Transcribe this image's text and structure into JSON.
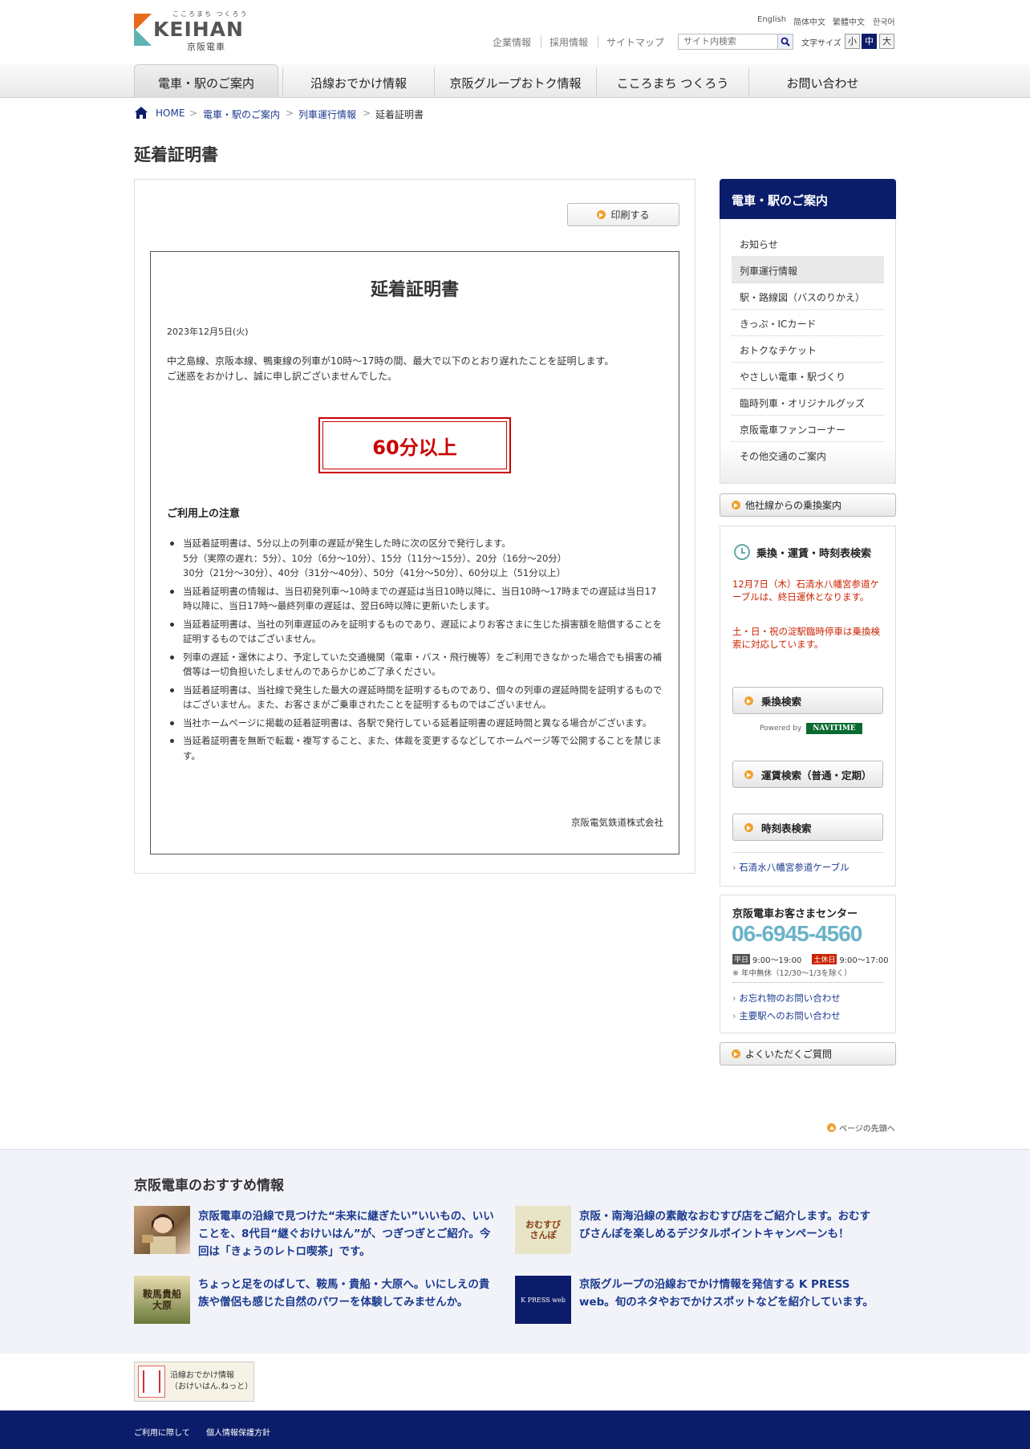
{
  "header": {
    "logo_ruby": "こころまち つくろう",
    "logo_main": "KEIHAN",
    "logo_jp": "京阪電車",
    "languages": [
      "English",
      "简体中文",
      "繁體中文",
      "한국어"
    ],
    "top_links": [
      "企業情報",
      "採用情報",
      "サイトマップ"
    ],
    "search_placeholder": "サイト内検索",
    "font_size_label": "文字サイズ",
    "font_sizes": [
      "小",
      "中",
      "大"
    ]
  },
  "gnav": [
    "電車・駅のご案内",
    "沿線おでかけ情報",
    "京阪グループおトク情報",
    "こころまち つくろう",
    "お問い合わせ"
  ],
  "breadcrumb": [
    "HOME",
    "電車・駅のご案内",
    "列車運行情報",
    "延着証明書"
  ],
  "page_title": "延着証明書",
  "print_label": "印刷する",
  "certificate": {
    "title": "延着証明書",
    "date": "2023年12月5日(火)",
    "body_line1": "中之島線、京阪本線、鴨東線の列車が10時～17時の間、最大で以下のとおり遅れたことを証明します。",
    "body_line2": "ご迷惑をおかけし、誠に申し訳ございませんでした。",
    "delay": "60分以上",
    "notes_heading": "ご利用上の注意",
    "notes": [
      [
        "当延着証明書は、5分以上の列車の遅延が発生した時に次の区分で発行します。",
        "5分（実際の遅れ：5分）、10分（6分～10分）、15分（11分～15分）、20分（16分～20分）",
        "30分（21分～30分）、40分（31分～40分）、50分（41分～50分）、60分以上（51分以上）"
      ],
      [
        "当延着証明書の情報は、当日初発列車～10時までの遅延は当日10時以降に、当日10時～17時までの遅延は当日17時以降に、当日17時～最終列車の遅延は、翌日6時以降に更新いたします。"
      ],
      [
        "当延着証明書は、当社の列車遅延のみを証明するものであり、遅延によりお客さまに生じた損害額を賠償することを証明するものではございません。"
      ],
      [
        "列車の遅延・運休により、予定していた交通機関（電車・バス・飛行機等）をご利用できなかった場合でも損害の補償等は一切負担いたしませんのであらかじめご了承ください。"
      ],
      [
        "当延着証明書は、当社線で発生した最大の遅延時間を証明するものであり、個々の列車の遅延時間を証明するものではございません。また、お客さまがご乗車されたことを証明するものではございません。"
      ],
      [
        "当社ホームページに掲載の延着証明書は、各駅で発行している延着証明書の遅延時間と異なる場合がございます。"
      ],
      [
        "当延着証明書を無断で転載・複写すること、また、体裁を変更するなどしてホームページ等で公開することを禁じます。"
      ]
    ],
    "signature": "京阪電気鉄道株式会社"
  },
  "sidebar": {
    "heading": "電車・駅のご案内",
    "items": [
      "お知らせ",
      "列車運行情報",
      "駅・路線図（バスのりかえ）",
      "きっぷ・ICカード",
      "おトクなチケット",
      "やさしい電車・駅づくり",
      "臨時列車・オリジナルグッズ",
      "京阪電車ファンコーナー",
      "その他交通のご案内"
    ],
    "other_lines": "他社線からの乗換案内",
    "transit_heading": "乗換・運賃・時刻表検索",
    "notice1": "12月7日（木）石清水八幡宮参道ケーブルは、終日運休となります。",
    "notice2": "土・日・祝の淀駅臨時停車は乗換検索に対応しています。",
    "transfer_btn": "乗換検索",
    "powered_by": "Powered by",
    "navitime": "NAVITIME",
    "fare_btn": "運賃検索（普通・定期）",
    "timetable_btn": "時刻表検索",
    "cable_link": "石清水八幡宮参道ケーブル",
    "center_heading": "京阪電車お客さまセンター",
    "phone": "06-6945-4560",
    "weekday_tag": "平日",
    "weekday_hours": "9:00～19:00",
    "holiday_tag": "土休日",
    "holiday_hours": "9:00～17:00",
    "hours_note": "※ 年中無休（12/30～1/3を除く）",
    "lost_link": "お忘れ物のお問い合わせ",
    "station_link": "主要駅へのお問い合わせ",
    "faq": "よくいただくご質問"
  },
  "page_top": "ページの先頭へ",
  "recommend": {
    "heading": "京阪電車のおすすめ情報",
    "items": [
      "京阪電車の沿線で見つけた“未来に継ぎたい”いいもの、いいことを、8代目“継ぐおけいはん”が、つぎつぎとご紹介。今回は「きょうのレトロ喫茶」です。",
      "京阪・南海沿線の素敵なおむすび店をご紹介します。おむすびさんぽを楽しめるデジタルポイントキャンペーンも！",
      "ちょっと足をのばして、鞍馬・貴船・大原へ。いにしえの貴族や僧侶も感じた自然のパワーを体験してみませんか。",
      "京阪グループの沿線おでかけ情報を発信する K PRESS web。旬のネタやおでかけスポットなどを紹介しています。"
    ],
    "thumb2_label": "おむすびさんぽ",
    "thumb3_label": "鞍馬貴船大原",
    "thumb4_label": "K PRESS web"
  },
  "banner": {
    "line1": "沿線おでかけ情報",
    "line2": "（おけいはん.ねっと）"
  },
  "footer": [
    "ご利用に際して",
    "個人情報保護方針"
  ]
}
